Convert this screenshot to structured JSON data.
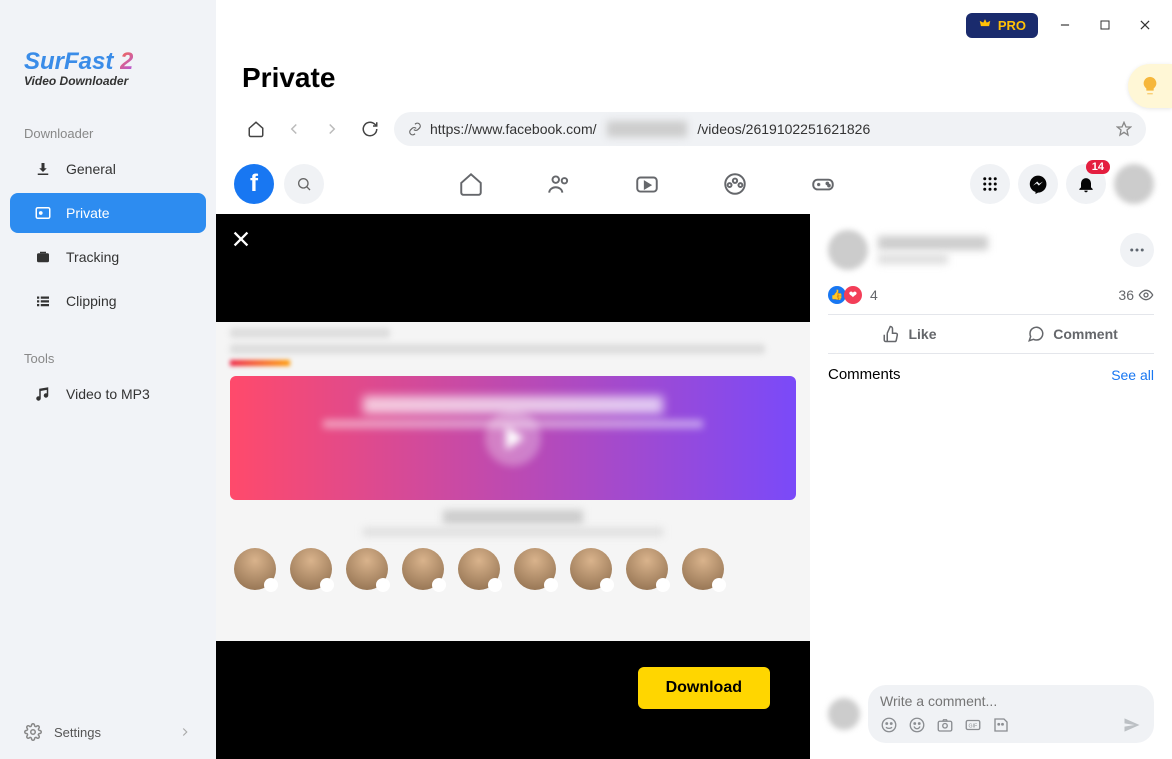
{
  "app": {
    "logo_pre": "Sur",
    "logo_post": "Fast",
    "logo_ver": "2",
    "logo_sub": "Video Downloader",
    "pro_label": "PRO"
  },
  "sidebar": {
    "sections": {
      "downloader_label": "Downloader",
      "tools_label": "Tools"
    },
    "items": {
      "general": "General",
      "private": "Private",
      "tracking": "Tracking",
      "clipping": "Clipping",
      "video_to_mp3": "Video to MP3"
    },
    "settings": "Settings"
  },
  "page": {
    "title": "Private",
    "url_prefix": "https://www.facebook.com/",
    "url_blurred": "xxxxx xxxxxx",
    "url_suffix": "/videos/2619102251621826"
  },
  "facebook": {
    "notification_count": "14",
    "reactions_count": "4",
    "views_count": "36",
    "like_label": "Like",
    "comment_label": "Comment",
    "comments_heading": "Comments",
    "see_all": "See all",
    "comment_placeholder": "Write a comment..."
  },
  "download_button": "Download"
}
